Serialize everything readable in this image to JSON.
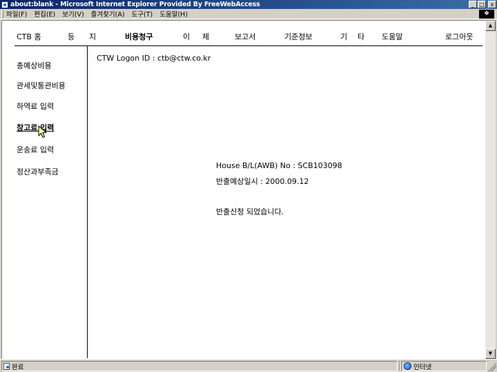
{
  "window": {
    "title": "about:blank - Microsoft Internet Explorer Provided By FreeWebAccess",
    "controls": {
      "minimize": "_",
      "maximize": "□",
      "close": "x"
    }
  },
  "menubar": {
    "items": [
      "파일(F)",
      "편집(E)",
      "보기(V)",
      "즐겨찾기(A)",
      "도구(T)",
      "도움말(H)"
    ]
  },
  "topnav": {
    "items": [
      {
        "label": "CTB 홈",
        "active": false
      },
      {
        "label": "등",
        "active": false
      },
      {
        "label": "지",
        "active": false
      },
      {
        "label": "비용청구",
        "active": true
      },
      {
        "label": "이",
        "active": false
      },
      {
        "label": "체",
        "active": false
      },
      {
        "label": "보고서",
        "active": false
      },
      {
        "label": "기준정보",
        "active": false
      },
      {
        "label": "기",
        "active": false
      },
      {
        "label": "타",
        "active": false
      },
      {
        "label": "도움말",
        "active": false
      },
      {
        "label": "로그아웃",
        "active": false
      }
    ]
  },
  "sidebar": {
    "items": [
      {
        "label": "총예상비용"
      },
      {
        "label": "관세및통관비용"
      },
      {
        "label": "하역료 입력"
      },
      {
        "label": "창고료 입력",
        "hover": true
      },
      {
        "label": "운송료 입력"
      },
      {
        "label": "정산과부족금"
      }
    ]
  },
  "main": {
    "logon": "CTW Logon ID : ctb@ctw.co.kr",
    "house_bl": "House B/L(AWB) No : SCB103098",
    "release_date": "반출예상일시 : 2000.09.12",
    "message": "반출신청 되었습니다."
  },
  "statusbar": {
    "status": "완료",
    "zone": "인터넷"
  }
}
